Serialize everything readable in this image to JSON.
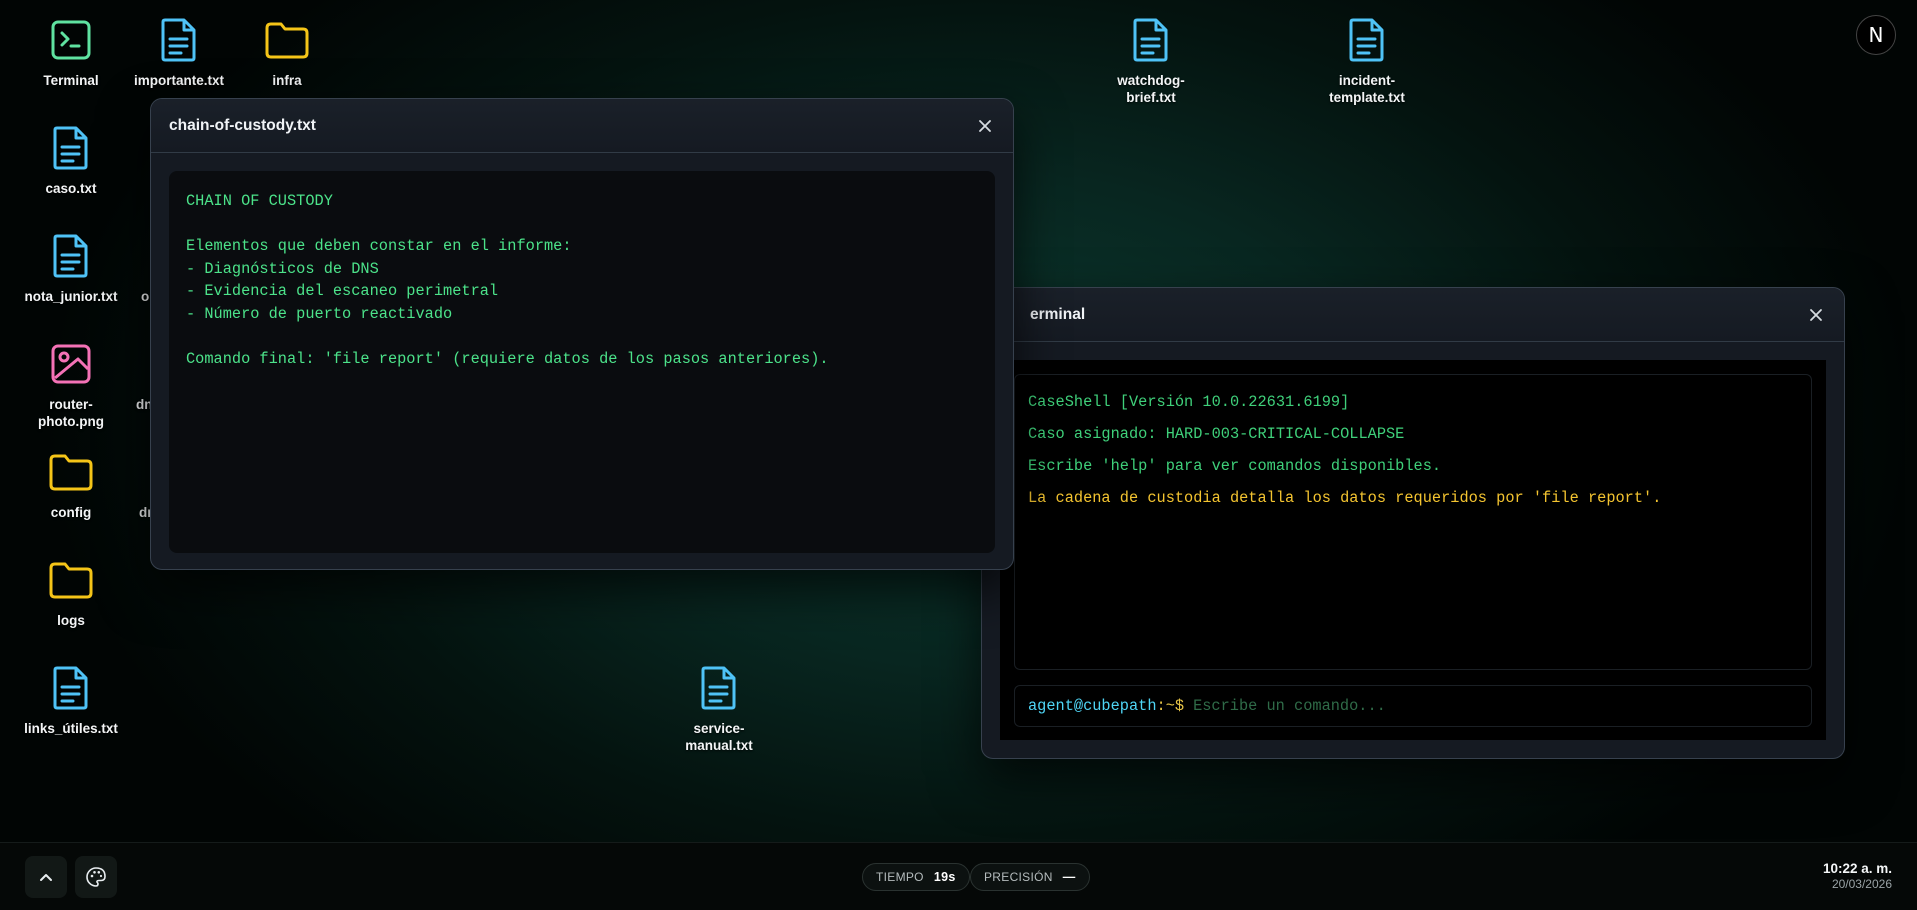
{
  "desktop": {
    "icons": [
      {
        "label": "Terminal",
        "icon": "terminal-icon"
      },
      {
        "label": "importante.txt",
        "icon": "document-icon"
      },
      {
        "label": "infra",
        "icon": "folder-icon"
      },
      {
        "label": "watchdog-brief.txt",
        "icon": "document-icon"
      },
      {
        "label": "incident-template.txt",
        "icon": "document-icon"
      },
      {
        "label": "caso.txt",
        "icon": "document-icon"
      },
      {
        "label": "nota_junior.txt",
        "icon": "document-icon"
      },
      {
        "label": "router-photo.png",
        "icon": "image-icon"
      },
      {
        "label": "config",
        "icon": "folder-icon"
      },
      {
        "label": "logs",
        "icon": "folder-icon"
      },
      {
        "label": "links_útiles.txt",
        "icon": "document-icon"
      },
      {
        "label": "service-manual.txt",
        "icon": "document-icon"
      }
    ],
    "partial_labels": [
      "o",
      "dn",
      "dr"
    ]
  },
  "doc_window": {
    "title": "chain-of-custody.txt",
    "lines": [
      "CHAIN OF CUSTODY",
      "",
      "Elementos que deben constar en el informe:",
      "- Diagnósticos de DNS",
      "- Evidencia del escaneo perimetral",
      "- Número de puerto reactivado",
      "",
      "Comando final: 'file report' (requiere datos de los pasos anteriores)."
    ]
  },
  "terminal_window": {
    "title": "erminal",
    "lines": [
      "CaseShell [Versión 10.0.22631.6199]",
      "Caso asignado: HARD-003-CRITICAL-COLLAPSE",
      "Escribe 'help' para ver comandos disponibles.",
      "La cadena de custodia detalla los datos requeridos por 'file report'."
    ],
    "prompt_user": "agent@cubepath",
    "prompt_tail": ":~$",
    "input_placeholder": "Escribe un comando...",
    "input_value": ""
  },
  "badge": {
    "letter": "N"
  },
  "taskbar": {
    "time_label": "TIEMPO",
    "time_value": "19s",
    "precision_label": "PRECISIÓN",
    "precision_value": "—",
    "clock_time": "10:22 a. m.",
    "clock_date": "20/03/2026"
  },
  "colors": {
    "doc_text": "#4ce38a",
    "terminal_green": "#3fd07a",
    "terminal_yellow": "#f4c430",
    "prompt_user": "#4fd5f5",
    "folder": "#f5c518",
    "document": "#4fc3f7",
    "image": "#f472b6",
    "terminal_icon": "#5fe3a1"
  }
}
